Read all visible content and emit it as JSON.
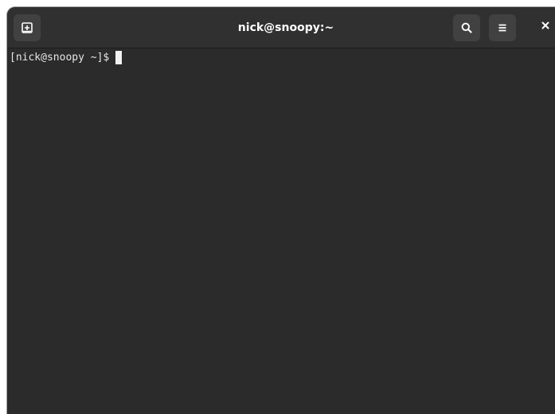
{
  "window": {
    "title": "nick@snoopy:~"
  },
  "headerbar": {
    "new_tab_icon": "new-tab-icon",
    "search_icon": "search-icon",
    "menu_icon": "hamburger-menu-icon",
    "close_icon": "close-icon"
  },
  "terminal": {
    "prompt": "[nick@snoopy ~]$"
  },
  "colors": {
    "background": "#2b2b2b",
    "headerbar": "#303030",
    "button": "#414141",
    "text": "#e6e6e6"
  }
}
